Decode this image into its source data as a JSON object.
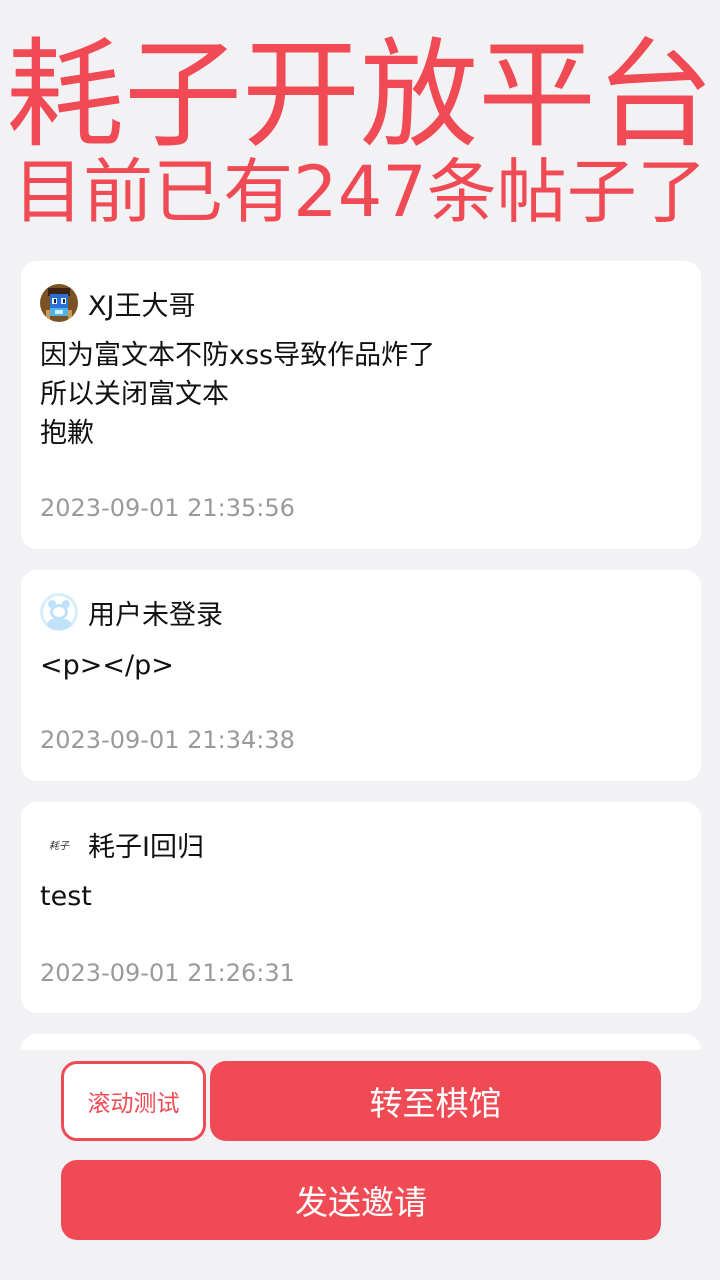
{
  "header": {
    "title": "耗子开放平台",
    "subtitle": "目前已有247条帖子了"
  },
  "posts": [
    {
      "author": "XJ王大哥",
      "avatar_icon": "pixel-character-avatar-icon",
      "lines": [
        "因为富文本不防xss导致作品炸了",
        "所以关闭富文本",
        "抱歉"
      ],
      "time": "2023-09-01 21:35:56"
    },
    {
      "author": "用户未登录",
      "avatar_icon": "default-user-avatar-icon",
      "lines": [
        "<p></p>"
      ],
      "time": "2023-09-01 21:34:38"
    },
    {
      "author": "耗子I回归",
      "avatar_icon": "logo-avatar-icon",
      "avatar_text": "耗子",
      "lines": [
        "test"
      ],
      "time": "2023-09-01 21:26:31"
    }
  ],
  "buttons": {
    "scroll_test": "滚动测试",
    "go_chess": "转至棋馆",
    "send_invite": "发送邀请"
  },
  "colors": {
    "accent": "#f04a55",
    "background": "#f2f2f4",
    "card": "#ffffff",
    "timestamp": "#9a9a9a"
  }
}
